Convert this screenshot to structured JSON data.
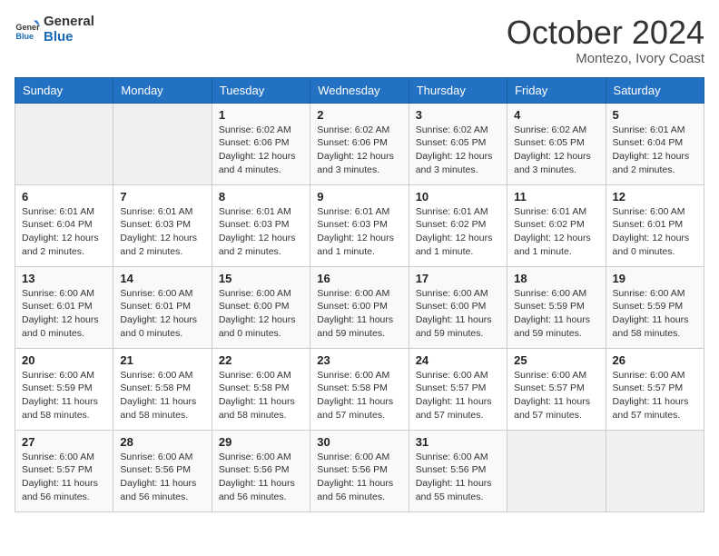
{
  "header": {
    "logo_line1": "General",
    "logo_line2": "Blue",
    "month": "October 2024",
    "location": "Montezo, Ivory Coast"
  },
  "weekdays": [
    "Sunday",
    "Monday",
    "Tuesday",
    "Wednesday",
    "Thursday",
    "Friday",
    "Saturday"
  ],
  "weeks": [
    [
      {
        "day": "",
        "info": ""
      },
      {
        "day": "",
        "info": ""
      },
      {
        "day": "1",
        "info": "Sunrise: 6:02 AM\nSunset: 6:06 PM\nDaylight: 12 hours and 4 minutes."
      },
      {
        "day": "2",
        "info": "Sunrise: 6:02 AM\nSunset: 6:06 PM\nDaylight: 12 hours and 3 minutes."
      },
      {
        "day": "3",
        "info": "Sunrise: 6:02 AM\nSunset: 6:05 PM\nDaylight: 12 hours and 3 minutes."
      },
      {
        "day": "4",
        "info": "Sunrise: 6:02 AM\nSunset: 6:05 PM\nDaylight: 12 hours and 3 minutes."
      },
      {
        "day": "5",
        "info": "Sunrise: 6:01 AM\nSunset: 6:04 PM\nDaylight: 12 hours and 2 minutes."
      }
    ],
    [
      {
        "day": "6",
        "info": "Sunrise: 6:01 AM\nSunset: 6:04 PM\nDaylight: 12 hours and 2 minutes."
      },
      {
        "day": "7",
        "info": "Sunrise: 6:01 AM\nSunset: 6:03 PM\nDaylight: 12 hours and 2 minutes."
      },
      {
        "day": "8",
        "info": "Sunrise: 6:01 AM\nSunset: 6:03 PM\nDaylight: 12 hours and 2 minutes."
      },
      {
        "day": "9",
        "info": "Sunrise: 6:01 AM\nSunset: 6:03 PM\nDaylight: 12 hours and 1 minute."
      },
      {
        "day": "10",
        "info": "Sunrise: 6:01 AM\nSunset: 6:02 PM\nDaylight: 12 hours and 1 minute."
      },
      {
        "day": "11",
        "info": "Sunrise: 6:01 AM\nSunset: 6:02 PM\nDaylight: 12 hours and 1 minute."
      },
      {
        "day": "12",
        "info": "Sunrise: 6:00 AM\nSunset: 6:01 PM\nDaylight: 12 hours and 0 minutes."
      }
    ],
    [
      {
        "day": "13",
        "info": "Sunrise: 6:00 AM\nSunset: 6:01 PM\nDaylight: 12 hours and 0 minutes."
      },
      {
        "day": "14",
        "info": "Sunrise: 6:00 AM\nSunset: 6:01 PM\nDaylight: 12 hours and 0 minutes."
      },
      {
        "day": "15",
        "info": "Sunrise: 6:00 AM\nSunset: 6:00 PM\nDaylight: 12 hours and 0 minutes."
      },
      {
        "day": "16",
        "info": "Sunrise: 6:00 AM\nSunset: 6:00 PM\nDaylight: 11 hours and 59 minutes."
      },
      {
        "day": "17",
        "info": "Sunrise: 6:00 AM\nSunset: 6:00 PM\nDaylight: 11 hours and 59 minutes."
      },
      {
        "day": "18",
        "info": "Sunrise: 6:00 AM\nSunset: 5:59 PM\nDaylight: 11 hours and 59 minutes."
      },
      {
        "day": "19",
        "info": "Sunrise: 6:00 AM\nSunset: 5:59 PM\nDaylight: 11 hours and 58 minutes."
      }
    ],
    [
      {
        "day": "20",
        "info": "Sunrise: 6:00 AM\nSunset: 5:59 PM\nDaylight: 11 hours and 58 minutes."
      },
      {
        "day": "21",
        "info": "Sunrise: 6:00 AM\nSunset: 5:58 PM\nDaylight: 11 hours and 58 minutes."
      },
      {
        "day": "22",
        "info": "Sunrise: 6:00 AM\nSunset: 5:58 PM\nDaylight: 11 hours and 58 minutes."
      },
      {
        "day": "23",
        "info": "Sunrise: 6:00 AM\nSunset: 5:58 PM\nDaylight: 11 hours and 57 minutes."
      },
      {
        "day": "24",
        "info": "Sunrise: 6:00 AM\nSunset: 5:57 PM\nDaylight: 11 hours and 57 minutes."
      },
      {
        "day": "25",
        "info": "Sunrise: 6:00 AM\nSunset: 5:57 PM\nDaylight: 11 hours and 57 minutes."
      },
      {
        "day": "26",
        "info": "Sunrise: 6:00 AM\nSunset: 5:57 PM\nDaylight: 11 hours and 57 minutes."
      }
    ],
    [
      {
        "day": "27",
        "info": "Sunrise: 6:00 AM\nSunset: 5:57 PM\nDaylight: 11 hours and 56 minutes."
      },
      {
        "day": "28",
        "info": "Sunrise: 6:00 AM\nSunset: 5:56 PM\nDaylight: 11 hours and 56 minutes."
      },
      {
        "day": "29",
        "info": "Sunrise: 6:00 AM\nSunset: 5:56 PM\nDaylight: 11 hours and 56 minutes."
      },
      {
        "day": "30",
        "info": "Sunrise: 6:00 AM\nSunset: 5:56 PM\nDaylight: 11 hours and 56 minutes."
      },
      {
        "day": "31",
        "info": "Sunrise: 6:00 AM\nSunset: 5:56 PM\nDaylight: 11 hours and 55 minutes."
      },
      {
        "day": "",
        "info": ""
      },
      {
        "day": "",
        "info": ""
      }
    ]
  ]
}
